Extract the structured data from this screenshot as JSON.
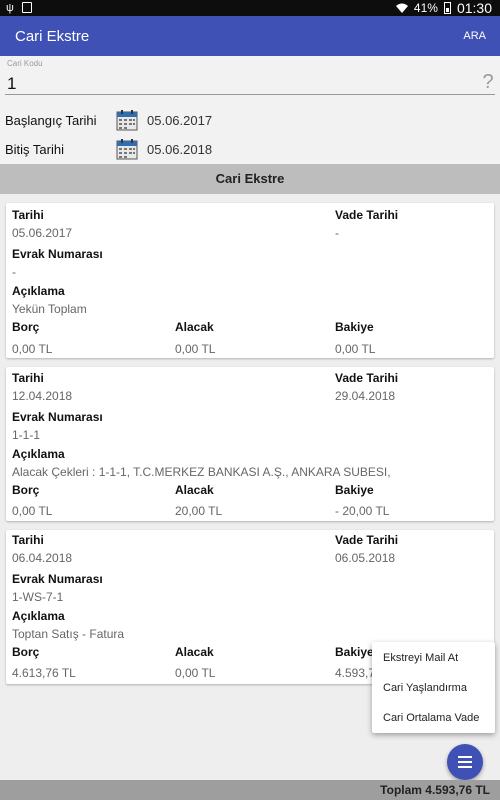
{
  "status_bar": {
    "battery": "41%",
    "time": "01:30"
  },
  "app_bar": {
    "title": "Cari Ekstre",
    "action": "ARA"
  },
  "form": {
    "cari_kodu_label": "Cari Kodu",
    "cari_kodu_value": "1",
    "baslangic_label": "Başlangıç Tarihi",
    "baslangic_value": "05.06.2017",
    "bitis_label": "Bitiş Tarihi",
    "bitis_value": "05.06.2018"
  },
  "section_title": "Cari Ekstre",
  "labels": {
    "tarihi": "Tarihi",
    "vade_tarihi": "Vade Tarihi",
    "evrak_numarasi": "Evrak Numarası",
    "aciklama": "Açıklama",
    "borc": "Borç",
    "alacak": "Alacak",
    "bakiye": "Bakiye"
  },
  "entries": [
    {
      "tarihi": "05.06.2017",
      "vade_tarihi": "-",
      "evrak_numarasi": "-",
      "aciklama": "Yekün Toplam",
      "borc": "0,00 TL",
      "alacak": "0,00 TL",
      "bakiye": "0,00 TL"
    },
    {
      "tarihi": "12.04.2018",
      "vade_tarihi": "29.04.2018",
      "evrak_numarasi": "1-1-1",
      "aciklama": "Alacak Çekleri : 1-1-1, T.C.MERKEZ BANKASI A.Ş., ANKARA SUBESI,",
      "borc": "0,00 TL",
      "alacak": "20,00 TL",
      "bakiye": "- 20,00 TL"
    },
    {
      "tarihi": "06.04.2018",
      "vade_tarihi": "06.05.2018",
      "evrak_numarasi": "1-WS-7-1",
      "aciklama": "Toptan Satış - Fatura",
      "borc": "4.613,76 TL",
      "alacak": "0,00 TL",
      "bakiye": "4.593,76 TL"
    }
  ],
  "menu": {
    "items": [
      "Ekstreyi Mail At",
      "Cari Yaşlandırma",
      "Cari Ortalama Vade"
    ]
  },
  "footer": {
    "total": "Toplam 4.593,76 TL"
  },
  "colors": {
    "primary": "#3f51b5",
    "status_bar": "#0d0d0d",
    "section_header": "#bdbdbd",
    "footer": "#9e9e9e"
  },
  "icons": {
    "help": "question-mark-icon",
    "calendar": "calendar-icon",
    "menu": "hamburger-menu-icon"
  }
}
